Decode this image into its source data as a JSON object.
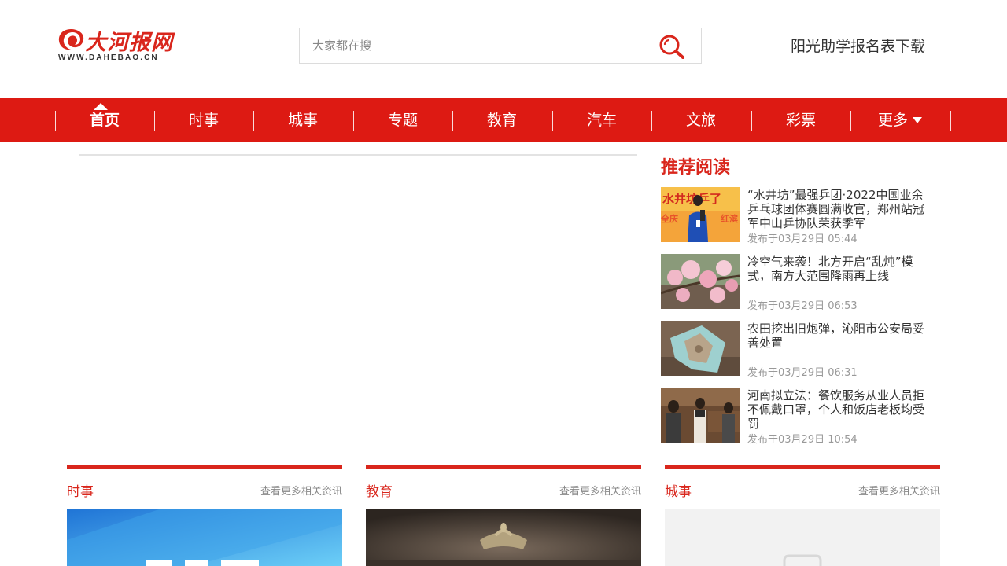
{
  "logo": {
    "text": "大河报网",
    "url": "WWW.DAHEBAO.CN"
  },
  "search": {
    "placeholder": "大家都在搜"
  },
  "header_link": "阳光助学报名表下载",
  "nav": {
    "items": [
      {
        "label": "首页",
        "active": true
      },
      {
        "label": "时事"
      },
      {
        "label": "城事"
      },
      {
        "label": "专题"
      },
      {
        "label": "教育"
      },
      {
        "label": "汽车"
      },
      {
        "label": "文旅"
      },
      {
        "label": "彩票"
      },
      {
        "label": "更多"
      }
    ]
  },
  "recommend": {
    "title": "推荐阅读",
    "items": [
      {
        "title": "“水井坊”最强乒团·2022中国业余乒乓球团体赛圆满收官，郑州站冠军中山乒协队荣获季军",
        "date": "发布于03月29日 05:44"
      },
      {
        "title": "冷空气来袭！北方开启“乱炖”模式，南方大范围降雨再上线",
        "date": "发布于03月29日 06:53"
      },
      {
        "title": "农田挖出旧炮弹，沁阳市公安局妥善处置",
        "date": "发布于03月29日 06:31"
      },
      {
        "title": "河南拟立法：餐饮服务从业人员拒不佩戴口罩，个人和饭店老板均受罚",
        "date": "发布于03月29日 10:54"
      }
    ]
  },
  "columns": [
    {
      "title": "时事",
      "more": "查看更多相关资讯"
    },
    {
      "title": "教育",
      "more": "查看更多相关资讯"
    },
    {
      "title": "城事",
      "more": "查看更多相关资讯"
    }
  ],
  "colors": {
    "brand_red": "#dd1a13",
    "title_red": "#d9261c"
  }
}
